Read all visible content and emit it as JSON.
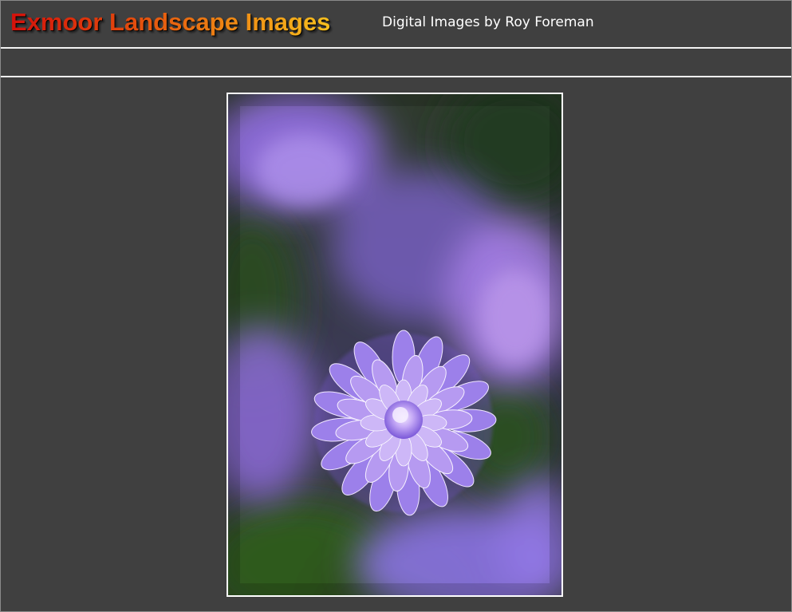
{
  "header": {
    "title": "Exmoor Landscape Images",
    "subtitle": "Digital Images by Roy Foreman"
  },
  "nav": {
    "items": []
  },
  "main": {
    "image": {
      "subject": "purple aster flower photograph"
    }
  },
  "colors": {
    "background": "#404040",
    "title_gradient_start": "#d3110b",
    "title_gradient_end": "#f6bf1e",
    "rule": "#f2f2f2",
    "image_border": "#ffffff"
  }
}
